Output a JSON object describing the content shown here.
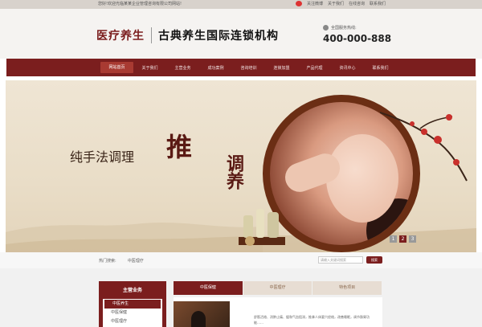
{
  "topbar": {
    "welcome": "您好!欢迎光临某某企业管理咨询有限公司网站!",
    "links": [
      "关注微博",
      "关于我们",
      "在线咨询",
      "联系我们"
    ]
  },
  "header": {
    "brand": "医疗养生",
    "slogan": "古典养生国际连锁机构",
    "hotline_label": "全国服务热线:",
    "hotline_number": "400-000-888"
  },
  "nav": {
    "items": [
      "网站首页",
      "关于我们",
      "主营业务",
      "成功案例",
      "咨询培训",
      "连锁加盟",
      "产品代理",
      "资讯中心",
      "联系我们"
    ]
  },
  "banner": {
    "text_main": "纯手法调理",
    "text_big": "推",
    "text_vertical": "调养",
    "pages": [
      "1",
      "2",
      "3"
    ]
  },
  "search": {
    "hot_label": "热门搜索:",
    "hot_item": "中医理疗",
    "placeholder": "请输入关键词搜索",
    "button": "搜索"
  },
  "sidebar": {
    "title": "主营业务",
    "items": [
      "中医养生",
      "中医保健",
      "中医理疗"
    ]
  },
  "tabs": {
    "items": [
      "中医保健",
      "中医理疗",
      "特色项目"
    ]
  },
  "content": {
    "desc": "舒筋活络、消肿止痛、缓和气血阻滞，推拿人体要穴经络，改善睡眠，调节肠胃功能……"
  },
  "colors": {
    "brand": "#7b1e1e",
    "nav_active": "#a83a32",
    "banner_bg": "#efe5d4"
  }
}
